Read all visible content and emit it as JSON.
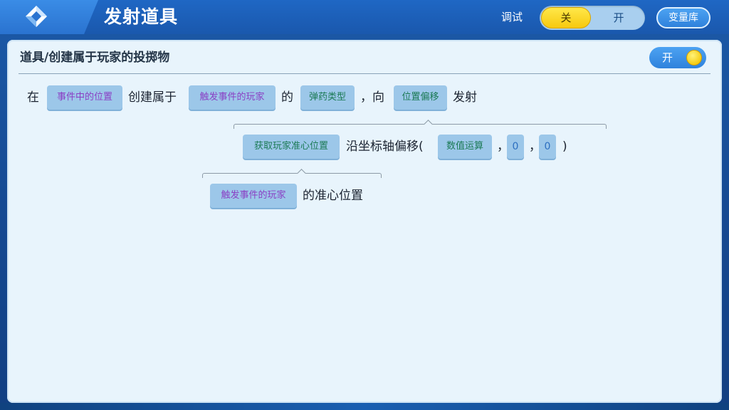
{
  "header": {
    "title": "发射道具",
    "back_icon": "diamond-back-icon",
    "debug_label": "调试",
    "debug_off": "关",
    "debug_on": "开",
    "debug_state": "off",
    "variable_library": "变量库"
  },
  "panel": {
    "title": "道具/创建属于玩家的投掷物",
    "enable_label": "开",
    "enabled": true
  },
  "expression": {
    "line1": {
      "t_at": "在",
      "c_event_pos": "事件中的位置",
      "t_create": "创建属于",
      "c_trigger_player": "触发事件的玩家",
      "t_of": "的",
      "c_ammo_type": "弹药类型",
      "t_comma_to": "，向",
      "c_pos_offset": "位置偏移",
      "t_fire": "发射"
    },
    "line2": {
      "c_get_aim": "获取玩家准心位置",
      "t_offset": "沿坐标轴偏移(",
      "c_math": "数值运算",
      "t_c1": "，",
      "v1": "0",
      "t_c2": "，",
      "v2": "0",
      "t_close": ")"
    },
    "line3": {
      "c_trigger_player": "触发事件的玩家",
      "t_aim_pos": "的准心位置"
    }
  },
  "colors": {
    "accent": "#2f82dc",
    "toggle_yellow": "#f7c90f",
    "chip_bg": "#9cc7e9",
    "chip_purple": "#8a3fc4",
    "chip_green": "#1b7a55"
  }
}
